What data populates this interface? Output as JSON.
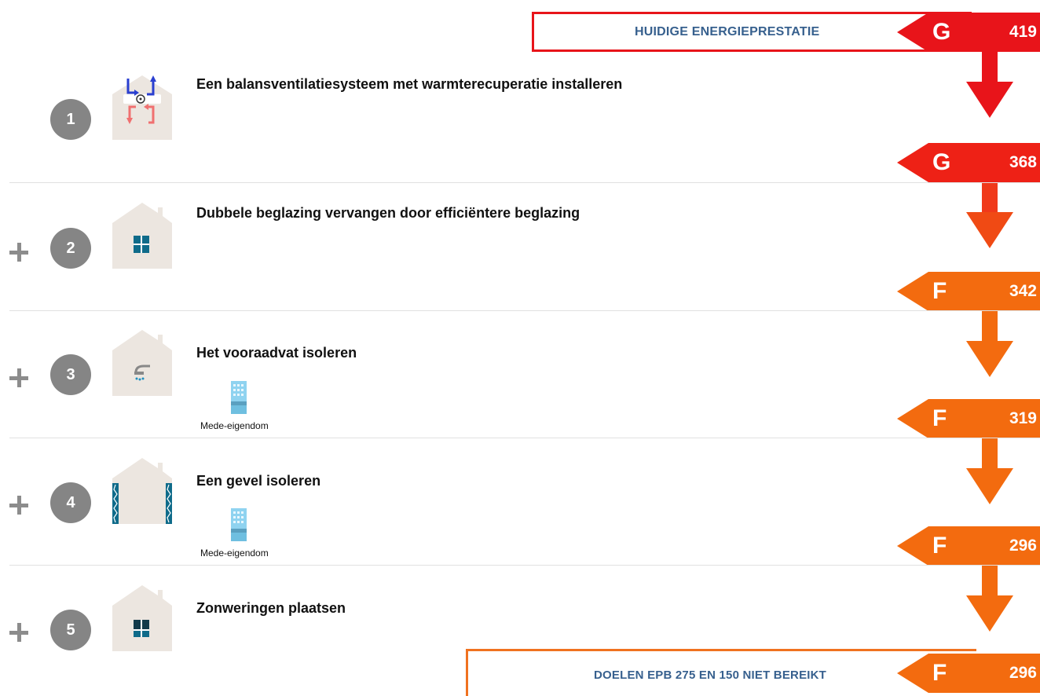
{
  "header": {
    "label": "HUIDIGE ENERGIEPRESTATIE"
  },
  "ratings": [
    {
      "class": "G",
      "value": "419",
      "color": "#e8141a"
    },
    {
      "class": "G",
      "value": "368",
      "color": "#ee2116"
    },
    {
      "class": "F",
      "value": "342",
      "color": "#f36b0f"
    },
    {
      "class": "F",
      "value": "319",
      "color": "#f36b0f"
    },
    {
      "class": "F",
      "value": "296",
      "color": "#f36b0f"
    },
    {
      "class": "F",
      "value": "296",
      "color": "#f36b0f"
    }
  ],
  "steps": [
    {
      "number": "1",
      "title": "Een balansventilatiesysteem met warmterecuperatie installeren",
      "icon": "ventilation-house-icon",
      "plus": false
    },
    {
      "number": "2",
      "title": "Dubbele beglazing vervangen door efficiëntere beglazing",
      "icon": "glazing-house-icon",
      "plus": true
    },
    {
      "number": "3",
      "title": "Het vooraadvat isoleren",
      "icon": "boiler-house-icon",
      "plus": true,
      "tag": "Mede-eigendom"
    },
    {
      "number": "4",
      "title": "Een gevel isoleren",
      "icon": "facade-house-icon",
      "plus": true,
      "tag": "Mede-eigendom"
    },
    {
      "number": "5",
      "title": "Zonweringen plaatsen",
      "icon": "shading-house-icon",
      "plus": true
    }
  ],
  "footer": {
    "label": "DOELEN EPB 275 EN 150 NIET BEREIKT"
  }
}
